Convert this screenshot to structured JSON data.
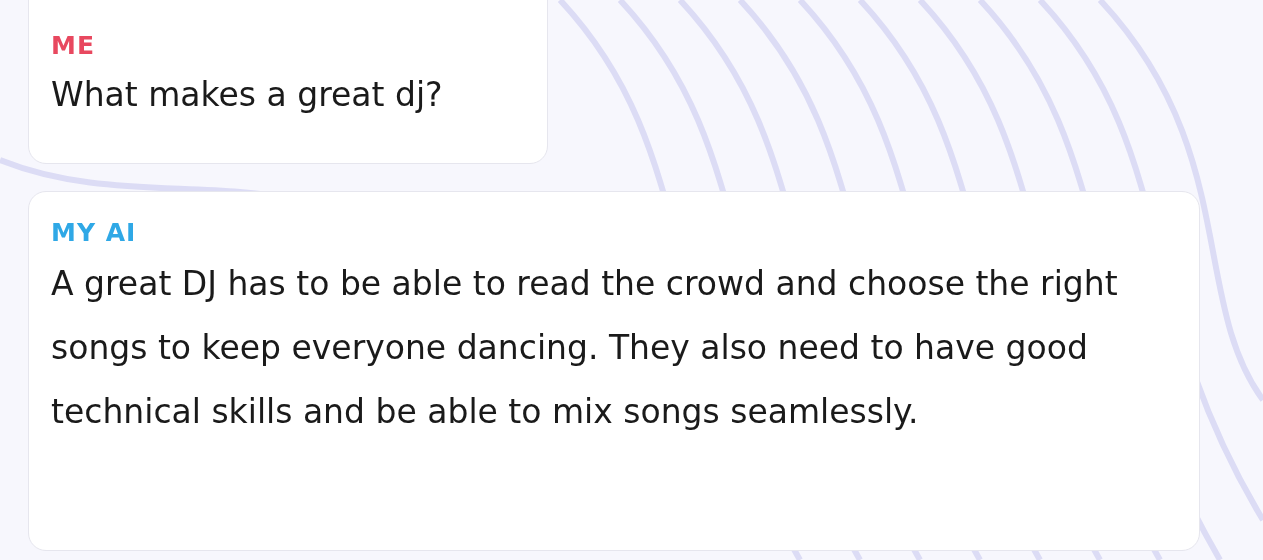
{
  "messages": [
    {
      "sender": "ME",
      "color": "#e8485f",
      "text": "What makes a great dj?"
    },
    {
      "sender": "MY AI",
      "color": "#2fa8e6",
      "text": "A great DJ has to be able to read the crowd and choose the right songs to keep everyone dancing. They also need to have good technical skills and be able to mix songs seamlessly."
    }
  ]
}
